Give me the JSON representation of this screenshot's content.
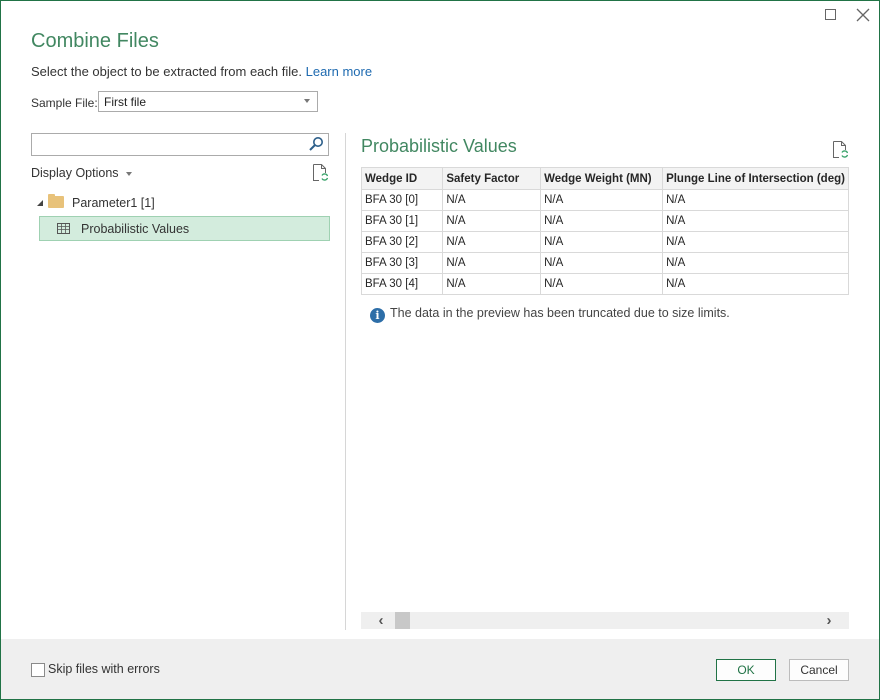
{
  "window": {
    "title": "Combine Files",
    "subtitle": "Select the object to be extracted from each file.",
    "learn_more": "Learn more",
    "maximize_icon": "maximize-icon",
    "close_icon": "close-icon"
  },
  "sample_file": {
    "label": "Sample File:",
    "value": "First file"
  },
  "navigator": {
    "search_placeholder": "",
    "search_value": "",
    "display_options": "Display Options",
    "tree": {
      "parent": {
        "label": "Parameter1 [1]",
        "icon": "folder-icon",
        "expanded": true
      },
      "children": [
        {
          "label": "Probabilistic Values",
          "icon": "table-icon",
          "selected": true
        }
      ]
    }
  },
  "preview": {
    "title": "Probabilistic Values",
    "columns": [
      "Wedge ID",
      "Safety Factor",
      "Wedge Weight (MN)",
      "Plunge Line of Intersection (deg)"
    ],
    "rows": [
      [
        "BFA 30 [0]",
        "N/A",
        "N/A",
        "N/A"
      ],
      [
        "BFA 30 [1]",
        "N/A",
        "N/A",
        "N/A"
      ],
      [
        "BFA 30 [2]",
        "N/A",
        "N/A",
        "N/A"
      ],
      [
        "BFA 30 [3]",
        "N/A",
        "N/A",
        "N/A"
      ],
      [
        "BFA 30 [4]",
        "N/A",
        "N/A",
        "N/A"
      ]
    ],
    "info_message": "The data in the preview has been truncated due to size limits."
  },
  "footer": {
    "skip_errors_label": "Skip files with errors",
    "skip_errors_checked": false,
    "ok_label": "OK",
    "cancel_label": "Cancel"
  },
  "colors": {
    "accent": "#217346",
    "link": "#1e6ab0",
    "selection_bg": "#d3ecdd",
    "info_icon": "#2d6ea8"
  }
}
